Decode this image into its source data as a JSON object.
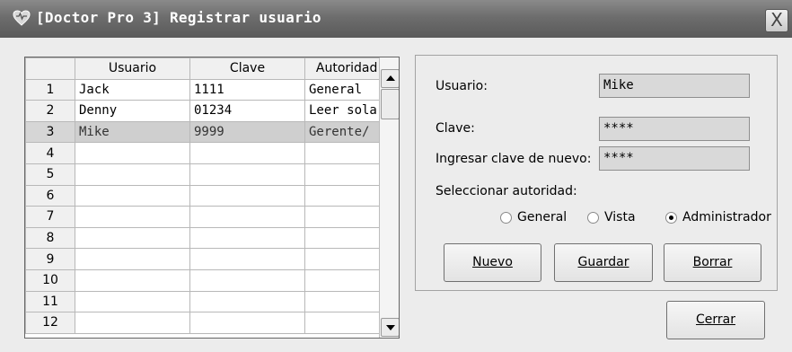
{
  "window": {
    "title": "[Doctor Pro 3] Registrar usuario",
    "close_glyph": "X"
  },
  "grid": {
    "columns": [
      "Usuario",
      "Clave",
      "Autoridad"
    ],
    "rows": [
      {
        "num": "1",
        "usuario": "Jack",
        "clave": "1111",
        "autoridad": "General"
      },
      {
        "num": "2",
        "usuario": "Denny",
        "clave": "01234",
        "autoridad": "Leer solar"
      },
      {
        "num": "3",
        "usuario": "Mike",
        "clave": "9999",
        "autoridad": "Gerente/"
      },
      {
        "num": "4",
        "usuario": "",
        "clave": "",
        "autoridad": ""
      },
      {
        "num": "5",
        "usuario": "",
        "clave": "",
        "autoridad": ""
      },
      {
        "num": "6",
        "usuario": "",
        "clave": "",
        "autoridad": ""
      },
      {
        "num": "7",
        "usuario": "",
        "clave": "",
        "autoridad": ""
      },
      {
        "num": "8",
        "usuario": "",
        "clave": "",
        "autoridad": ""
      },
      {
        "num": "9",
        "usuario": "",
        "clave": "",
        "autoridad": ""
      },
      {
        "num": "10",
        "usuario": "",
        "clave": "",
        "autoridad": ""
      },
      {
        "num": "11",
        "usuario": "",
        "clave": "",
        "autoridad": ""
      },
      {
        "num": "12",
        "usuario": "",
        "clave": "",
        "autoridad": ""
      }
    ],
    "selected_row": "3"
  },
  "form": {
    "usuario_label": "Usuario:",
    "usuario_value": "Mike",
    "clave_label": "Clave:",
    "clave_value": "****",
    "clave_repeat_label": "Ingresar clave de nuevo:",
    "clave_repeat_value": "****",
    "autoridad_label": "Seleccionar autoridad:",
    "radios": [
      {
        "label": "General",
        "checked": false
      },
      {
        "label": "Vista",
        "checked": false
      },
      {
        "label": "Administrador",
        "checked": true
      }
    ]
  },
  "buttons": {
    "nuevo": {
      "mnemonic": "N",
      "rest": "uevo"
    },
    "guardar": {
      "mnemonic": "G",
      "rest": "uardar"
    },
    "borrar": {
      "mnemonic": "B",
      "rest": "orrar"
    },
    "cerrar": {
      "mnemonic": "C",
      "rest": "errar"
    }
  },
  "colors": {
    "titlebar": "#6d6d6d",
    "selected_row": "#cfcfcf",
    "field_bg": "#d9d9d9"
  }
}
